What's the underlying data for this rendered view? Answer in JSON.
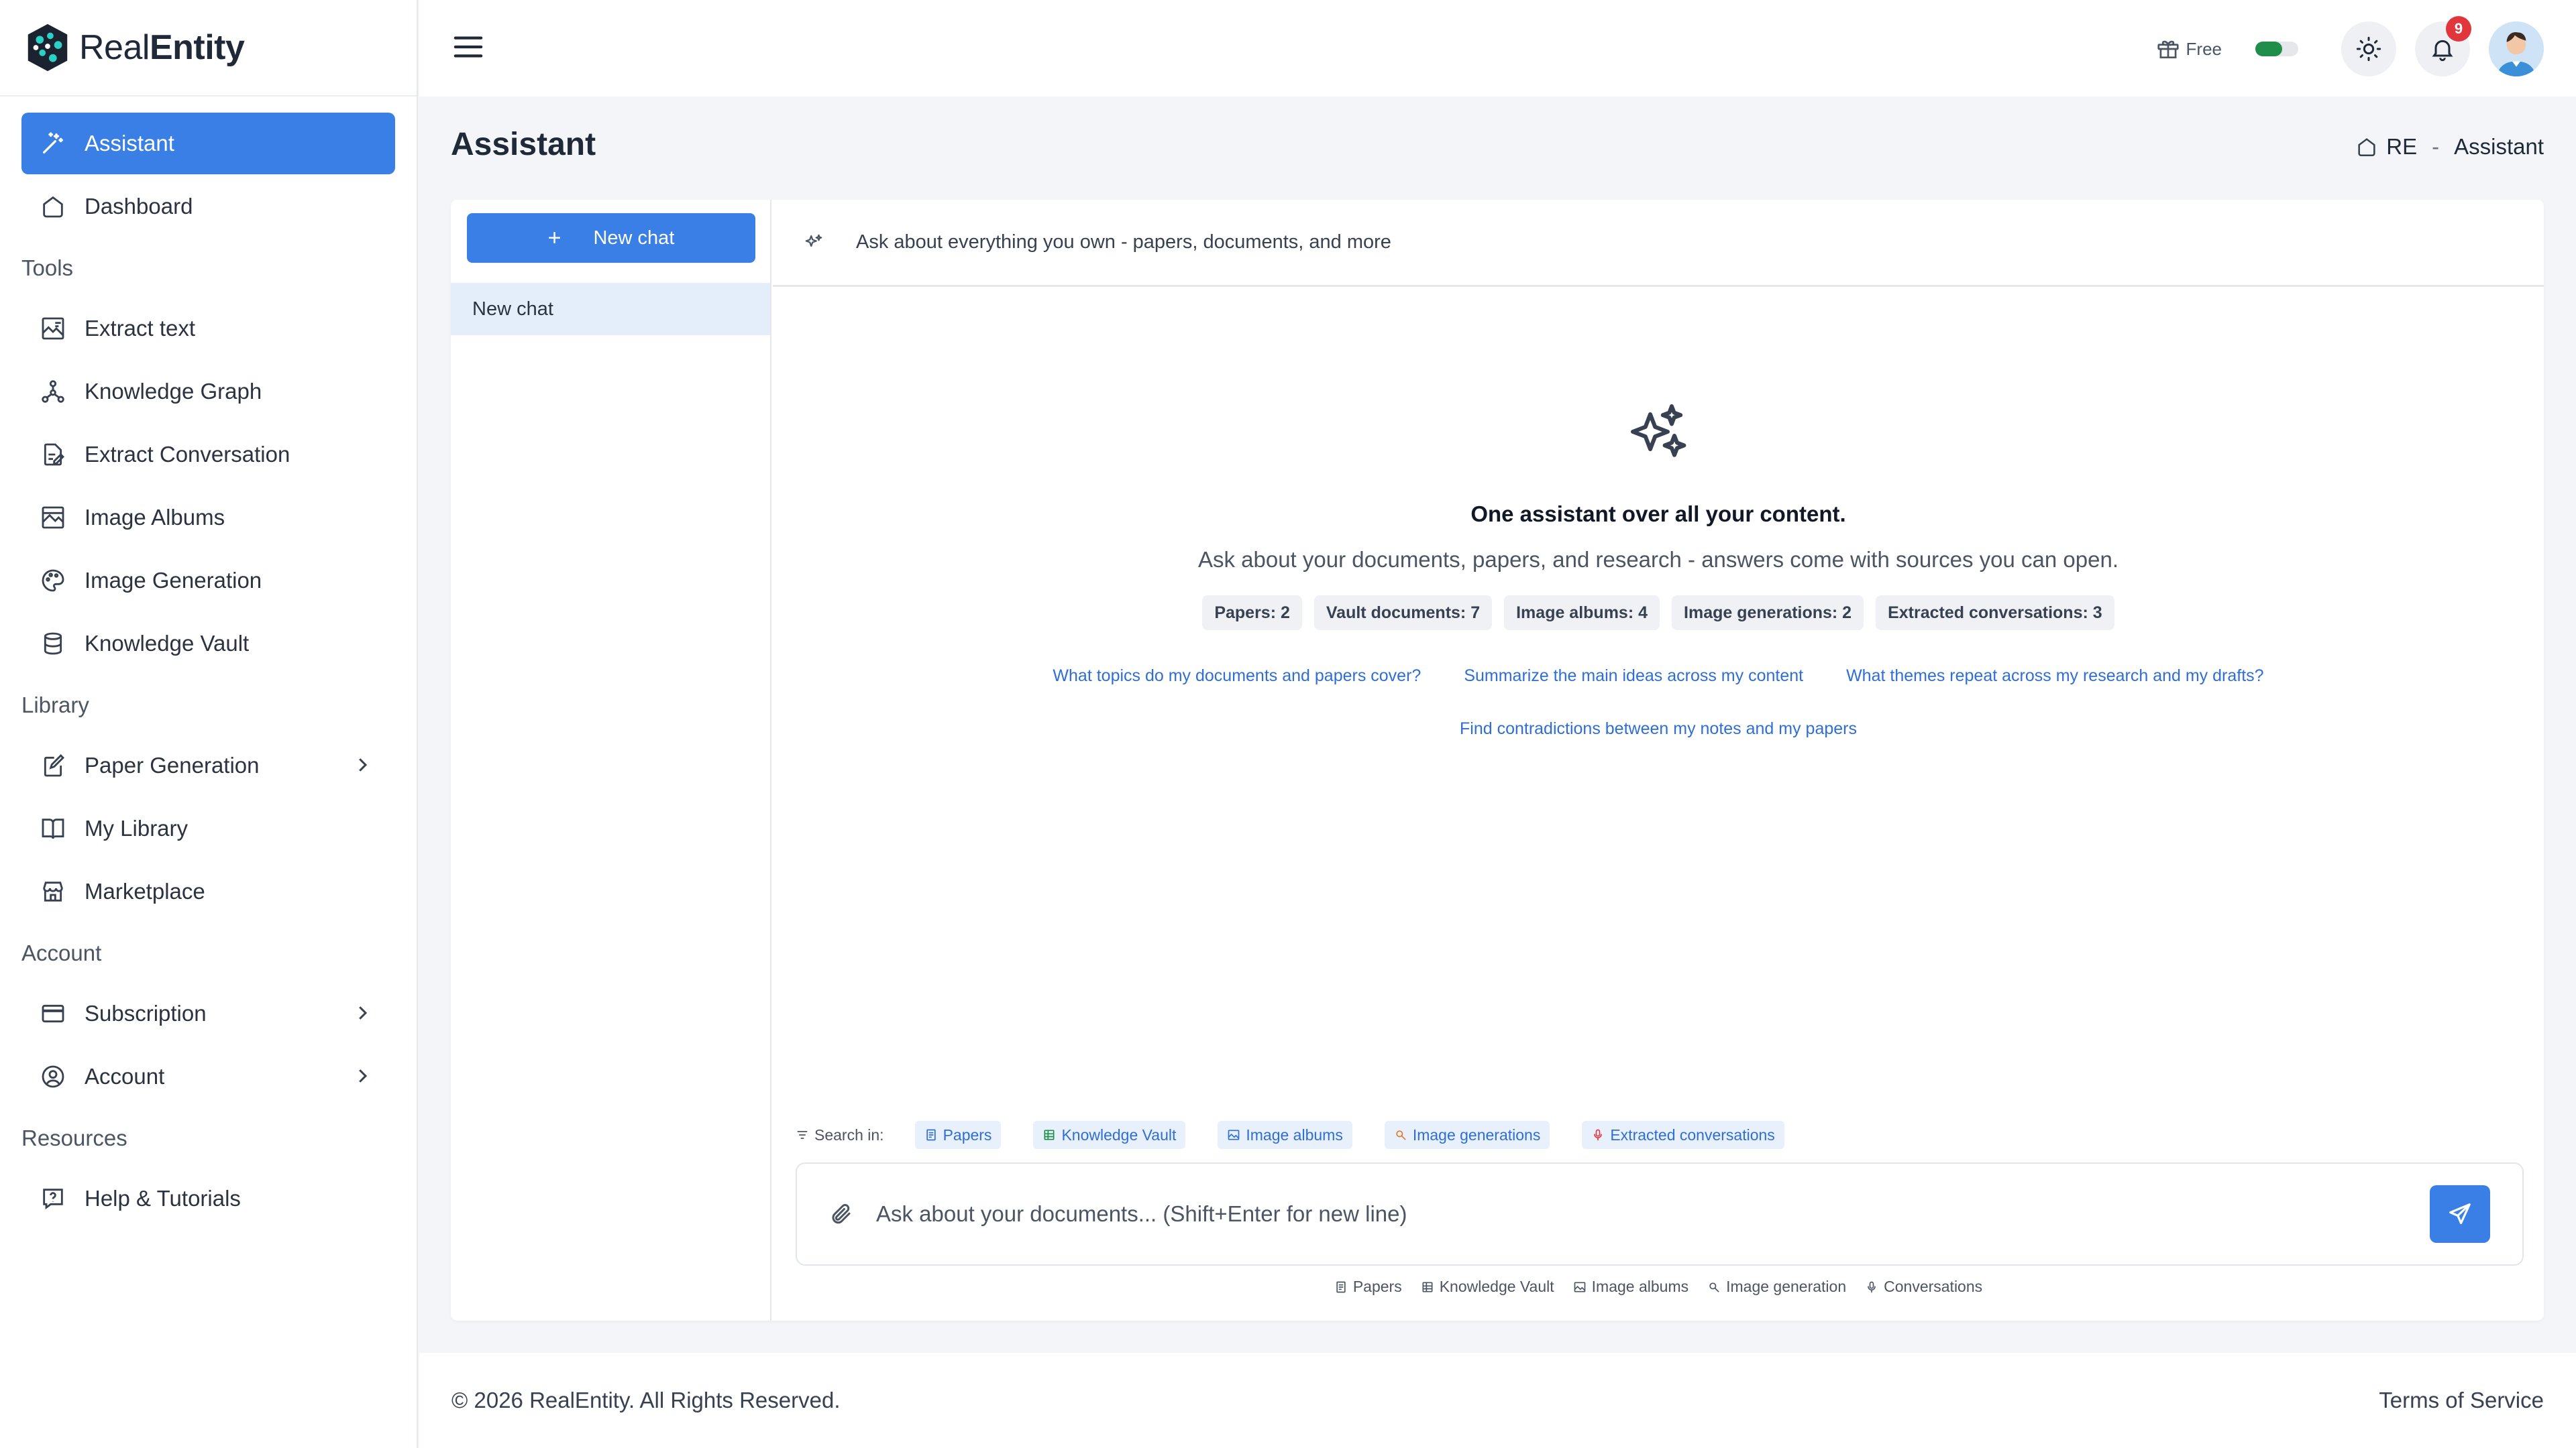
{
  "brand": {
    "name_light": "Real",
    "name_bold": "Entity"
  },
  "sidebar": {
    "items": [
      {
        "label": "Assistant",
        "icon": "magic-wand-icon",
        "active": true
      },
      {
        "label": "Dashboard",
        "icon": "home-icon"
      }
    ],
    "sections": [
      {
        "title": "Tools",
        "items": [
          {
            "label": "Extract text",
            "icon": "image-text-icon"
          },
          {
            "label": "Knowledge Graph",
            "icon": "graph-nodes-icon"
          },
          {
            "label": "Extract Conversation",
            "icon": "document-edit-icon"
          },
          {
            "label": "Image Albums",
            "icon": "album-icon"
          },
          {
            "label": "Image Generation",
            "icon": "palette-icon"
          },
          {
            "label": "Knowledge Vault",
            "icon": "database-icon"
          }
        ]
      },
      {
        "title": "Library",
        "items": [
          {
            "label": "Paper Generation",
            "icon": "paper-edit-icon",
            "chevron": true
          },
          {
            "label": "My Library",
            "icon": "book-open-icon"
          },
          {
            "label": "Marketplace",
            "icon": "store-icon"
          }
        ]
      },
      {
        "title": "Account",
        "items": [
          {
            "label": "Subscription",
            "icon": "credit-card-icon",
            "chevron": true
          },
          {
            "label": "Account",
            "icon": "user-circle-icon",
            "chevron": true
          }
        ]
      },
      {
        "title": "Resources",
        "items": [
          {
            "label": "Help & Tutorials",
            "icon": "help-icon"
          }
        ]
      }
    ]
  },
  "header": {
    "plan": "Free",
    "notifications_count": "9"
  },
  "page": {
    "title": "Assistant",
    "breadcrumb_root": "RE",
    "breadcrumb_sep": "-",
    "breadcrumb_current": "Assistant"
  },
  "chat_list": {
    "new_chat_label": "New chat",
    "plus": "+",
    "entries": [
      "New chat"
    ]
  },
  "chat": {
    "header_prompt": "Ask about everything you own - papers, documents, and more",
    "hero_title": "One assistant over all your content.",
    "hero_subtitle": "Ask about your documents, papers, and research - answers come with sources you can open.",
    "stats": [
      "Papers: 2",
      "Vault documents: 7",
      "Image albums: 4",
      "Image generations: 2",
      "Extracted conversations: 3"
    ],
    "suggestions_row1": [
      "What topics do my documents and papers cover?",
      "Summarize the main ideas across my content",
      "What themes repeat across my research and my drafts?"
    ],
    "suggestions_row2": [
      "Find contradictions between my notes and my papers"
    ],
    "search_in_label": "Search in:",
    "scopes": [
      "Papers",
      "Knowledge Vault",
      "Image albums",
      "Image generations",
      "Extracted conversations"
    ],
    "input_placeholder": "Ask about your documents... (Shift+Enter for new line)",
    "sources": [
      "Papers",
      "Knowledge Vault",
      "Image albums",
      "Image generation",
      "Conversations"
    ]
  },
  "footer": {
    "copyright": "© 2026 RealEntity. All Rights Reserved.",
    "terms": "Terms of Service"
  },
  "colors": {
    "accent": "#3a7fe6",
    "active_chat_bg": "#e4eefb",
    "badge": "#e0363c",
    "toggle": "#1e8e4a",
    "link": "#2f6ed6"
  }
}
